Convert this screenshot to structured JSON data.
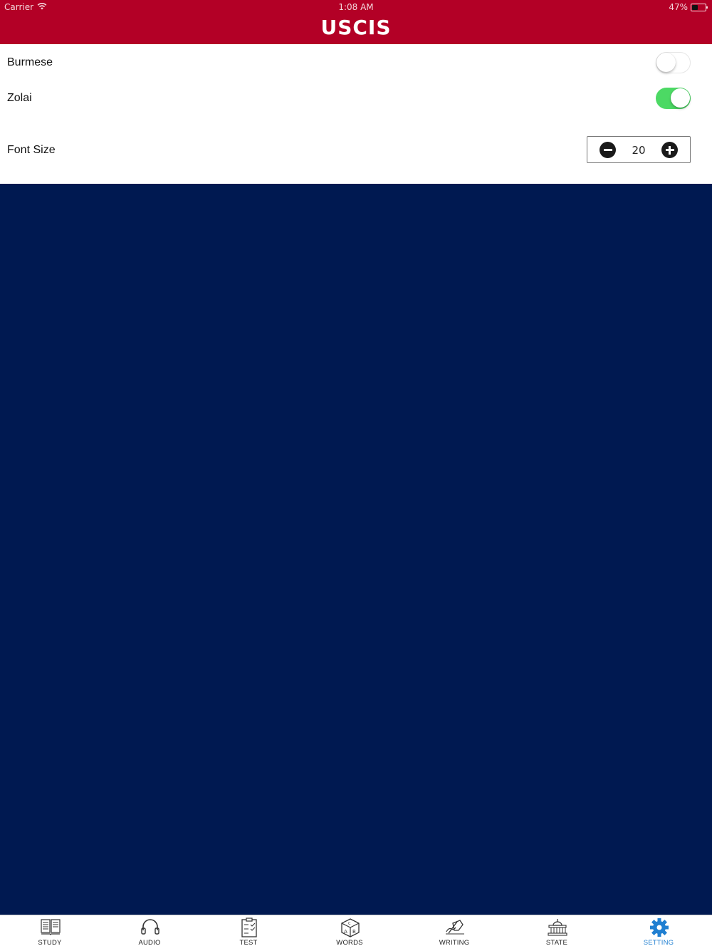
{
  "status_bar": {
    "carrier": "Carrier",
    "time": "1:08 AM",
    "battery": "47%",
    "battery_level": 0.47
  },
  "header": {
    "title": "USCIS"
  },
  "settings": {
    "burmese": {
      "label": "Burmese",
      "enabled": false
    },
    "zolai": {
      "label": "Zolai",
      "enabled": true
    },
    "font_size": {
      "label": "Font Size",
      "value": "20"
    }
  },
  "colors": {
    "header": "#b30026",
    "background": "#001951",
    "toggle_on": "#4cd964",
    "active_tab": "#1f7fd1"
  },
  "tabbar": {
    "items": [
      {
        "label": "STUDY",
        "icon": "book-icon"
      },
      {
        "label": "AUDIO",
        "icon": "headphones-icon"
      },
      {
        "label": "TEST",
        "icon": "clipboard-icon"
      },
      {
        "label": "WORDS",
        "icon": "abc-cube-icon"
      },
      {
        "label": "WRITING",
        "icon": "hand-writing-icon"
      },
      {
        "label": "STATE",
        "icon": "capitol-building-icon"
      },
      {
        "label": "SETTING",
        "icon": "gear-icon",
        "active": true
      }
    ]
  }
}
